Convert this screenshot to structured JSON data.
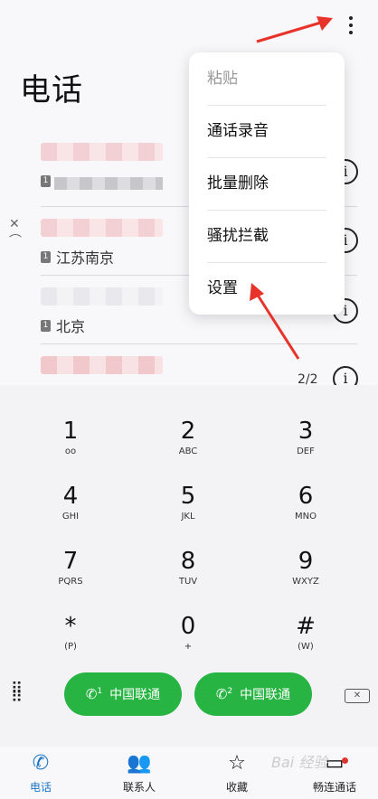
{
  "header": {
    "title": "电话"
  },
  "contacts": [
    {
      "location": "",
      "has_info": true
    },
    {
      "location": "江苏南京",
      "has_info": true
    },
    {
      "location": "北京",
      "has_info": true
    },
    {
      "location": "",
      "has_info": true,
      "count": "2/2"
    }
  ],
  "sim_label": "1",
  "menu": {
    "items": [
      "粘贴",
      "通话录音",
      "批量删除",
      "骚扰拦截",
      "设置"
    ]
  },
  "dialpad": {
    "keys": [
      {
        "digit": "1",
        "letters": "ᴏᴏ"
      },
      {
        "digit": "2",
        "letters": "ABC"
      },
      {
        "digit": "3",
        "letters": "DEF"
      },
      {
        "digit": "4",
        "letters": "GHI"
      },
      {
        "digit": "5",
        "letters": "JKL"
      },
      {
        "digit": "6",
        "letters": "MNO"
      },
      {
        "digit": "7",
        "letters": "PQRS"
      },
      {
        "digit": "8",
        "letters": "TUV"
      },
      {
        "digit": "9",
        "letters": "WXYZ"
      },
      {
        "digit": "*",
        "letters": "(P)"
      },
      {
        "digit": "0",
        "letters": "+"
      },
      {
        "digit": "#",
        "letters": "(W)"
      }
    ]
  },
  "call_buttons": [
    {
      "sim": "1",
      "label": "中国联通"
    },
    {
      "sim": "2",
      "label": "中国联通"
    }
  ],
  "nav": [
    {
      "label": "电话",
      "icon": "phone-icon"
    },
    {
      "label": "联系人",
      "icon": "contacts-icon"
    },
    {
      "label": "收藏",
      "icon": "star-icon"
    },
    {
      "label": "畅连通话",
      "icon": "video-call-icon"
    }
  ],
  "colors": {
    "accent": "#1b77c7",
    "call_green": "#27b443",
    "badge_red": "#e0352f",
    "arrow_red": "#e8332a"
  }
}
